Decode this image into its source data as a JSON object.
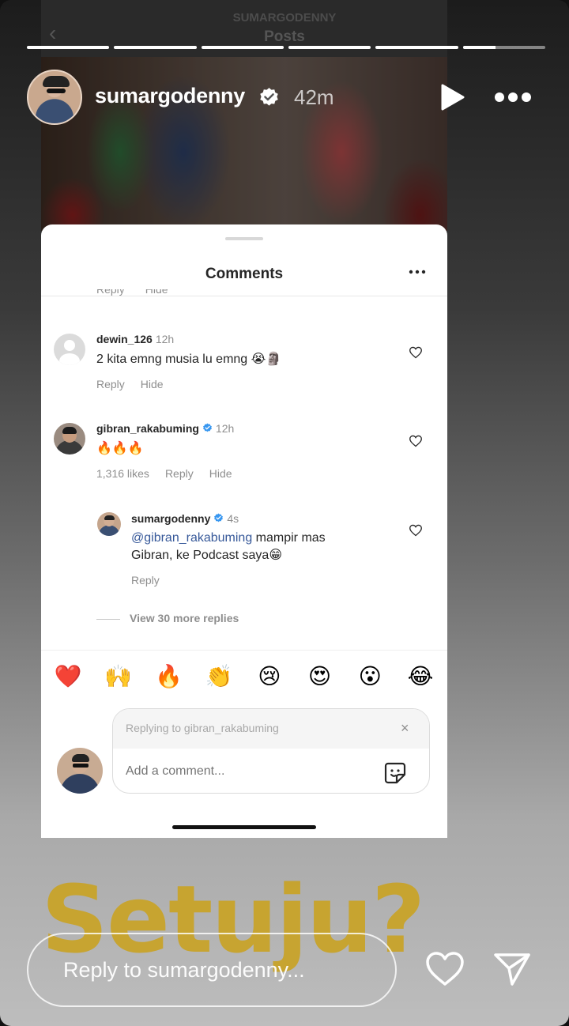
{
  "background_screen": {
    "username": "SUMARGODENNY",
    "title": "Posts"
  },
  "story": {
    "progress": [
      1,
      1,
      1,
      1,
      1,
      0.4
    ],
    "username": "sumargodenny",
    "time": "42m"
  },
  "comments_sheet": {
    "title": "Comments",
    "clipped_actions": [
      "Reply",
      "Hide"
    ],
    "comments": [
      {
        "username": "dewin_126",
        "time": "12h",
        "text": "2 kita emng musia lu emng 😭🗿",
        "actions": [
          "Reply",
          "Hide"
        ]
      },
      {
        "username": "gibran_rakabuming",
        "verified": true,
        "time": "12h",
        "text": "🔥🔥🔥",
        "likes": "1,316 likes",
        "actions": [
          "Reply",
          "Hide"
        ]
      }
    ],
    "reply": {
      "username": "sumargodenny",
      "verified": true,
      "time": "4s",
      "mention": "@gibran_rakabuming",
      "text": " mampir mas Gibran, ke Podcast saya😁",
      "action": "Reply"
    },
    "view_more_replies": "View 30 more replies",
    "emojis": [
      "❤️",
      "🙌",
      "🔥",
      "👏",
      "😢",
      "😍",
      "😮",
      "😂"
    ],
    "replying_to": "Replying to gibran_rakabuming",
    "close_symbol": "×",
    "comment_placeholder": "Add a comment..."
  },
  "overlay_text": "Setuju?",
  "reply_bar": {
    "placeholder": "Reply to sumargodenny..."
  },
  "colors": {
    "accent_gold": "#c9a326",
    "verified_blue": "#3897f0",
    "mention_blue": "#365899"
  },
  "icons": [
    "verified-icon",
    "play-icon",
    "more-icon",
    "heart-icon",
    "sticker-icon",
    "send-icon",
    "close-icon"
  ]
}
